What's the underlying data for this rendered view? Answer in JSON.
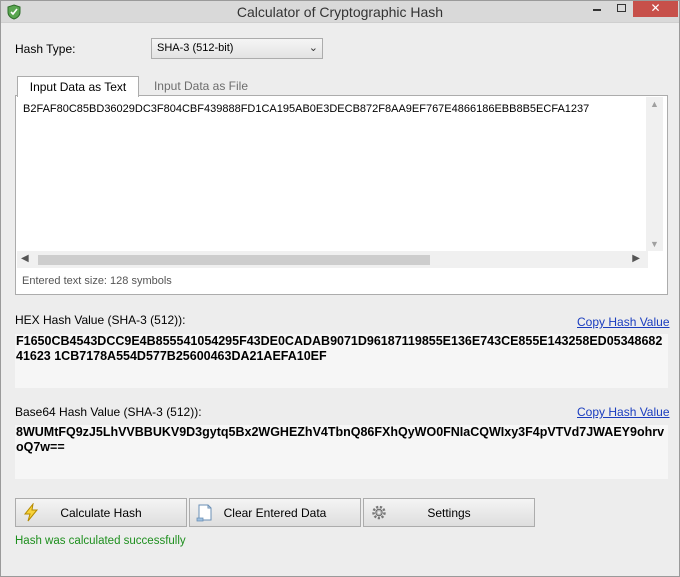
{
  "window": {
    "title": "Calculator of Cryptographic Hash"
  },
  "hash_type": {
    "label": "Hash Type:",
    "selected": "SHA-3 (512-bit)"
  },
  "tabs": [
    {
      "label": "Input Data as Text",
      "active": true
    },
    {
      "label": "Input Data as File",
      "active": false
    }
  ],
  "input": {
    "text": "B2FAF80C85BD36029DC3F804CBF439888FD1CA195AB0E3DECB872F8AA9EF767E4866186EBB8B5ECFA1237",
    "size_text": "Entered text size: 128 symbols"
  },
  "hex": {
    "label": "HEX Hash Value (SHA-3 (512)):",
    "copy_label": "Copy Hash Value",
    "value": "F1650CB4543DCC9E4B855541054295F43DE0CADAB9071D96187119855E136E743CE855E143258ED0534868241623 1CB7178A554D577B25600463DA21AEFA10EF"
  },
  "base64": {
    "label": "Base64 Hash Value (SHA-3 (512)):",
    "copy_label": "Copy Hash Value",
    "value": "8WUMtFQ9zJ5LhVVBBUKV9D3gytq5Bx2WGHEZhV4TbnQ86FXhQyWO0FNIaCQWIxy3F4pVTVd7JWAEY9ohrvoQ7w=="
  },
  "buttons": {
    "calculate": "Calculate Hash",
    "clear": "Clear Entered Data",
    "settings": "Settings"
  },
  "status": "Hash was calculated successfully",
  "colors": {
    "link": "#1a3dbf",
    "status": "#1e8f1e",
    "close": "#c7504a"
  }
}
